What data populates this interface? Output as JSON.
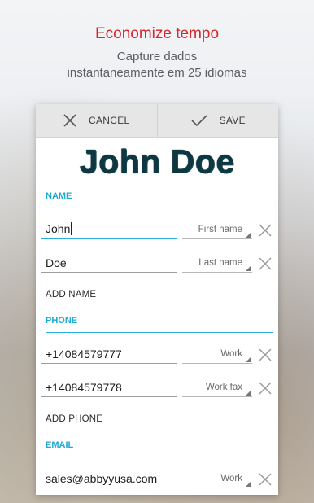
{
  "hero": {
    "title": "Economize tempo",
    "subtitle_line1": "Capture dados",
    "subtitle_line2": "instantaneamente em 25 idiomas"
  },
  "toolbar": {
    "cancel_label": "CANCEL",
    "save_label": "SAVE"
  },
  "card_image_text": "John Doe",
  "sections": {
    "name": {
      "header": "NAME",
      "rows": [
        {
          "value": "John",
          "type": "First name"
        },
        {
          "value": "Doe",
          "type": "Last name"
        }
      ],
      "add_label": "ADD NAME"
    },
    "phone": {
      "header": "PHONE",
      "rows": [
        {
          "value": "+14084579777",
          "type": "Work"
        },
        {
          "value": "+14084579778",
          "type": "Work fax"
        }
      ],
      "add_label": "ADD PHONE"
    },
    "email": {
      "header": "EMAIL",
      "rows": [
        {
          "value": "sales@abbyyusa.com",
          "type": "Work"
        }
      ]
    }
  }
}
